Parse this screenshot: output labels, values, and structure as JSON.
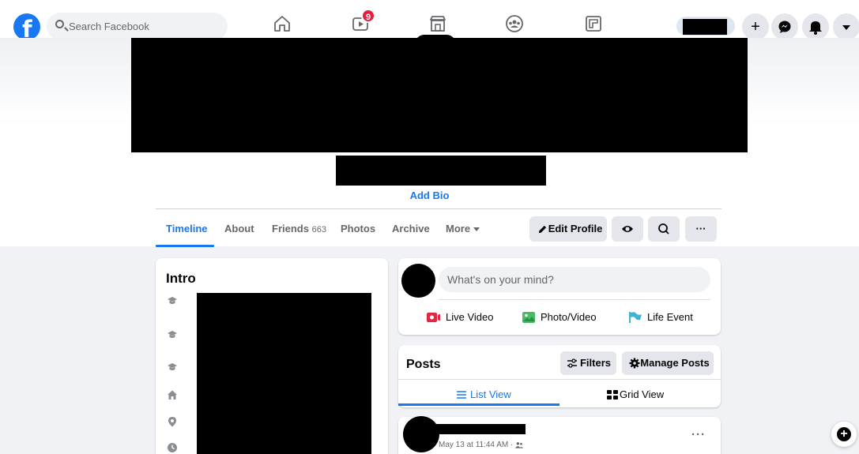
{
  "topbar": {
    "logo_glyph": "f",
    "search_placeholder": "Search Facebook",
    "nav_icons": [
      "home-icon",
      "watch-icon",
      "marketplace-icon",
      "groups-icon",
      "gaming-icon"
    ],
    "watch_badge": "9",
    "right_buttons": [
      "plus-icon",
      "messenger-icon",
      "bell-icon",
      "caret-down-icon"
    ],
    "accent": "#1877f2",
    "badge_color": "#e41e3f"
  },
  "profile": {
    "add_bio": "Add Bio"
  },
  "tabs": {
    "timeline": "Timeline",
    "about": "About",
    "friends": "Friends",
    "friends_count": "663",
    "photos": "Photos",
    "archive": "Archive",
    "more": "More"
  },
  "actions": {
    "edit_profile": "Edit Profile"
  },
  "intro": {
    "title": "Intro",
    "icons": [
      "graduation-cap-icon",
      "graduation-cap-icon",
      "graduation-cap-icon",
      "home-icon",
      "location-pin-icon",
      "clock-icon"
    ]
  },
  "composer": {
    "placeholder": "What's on your mind?",
    "live_video": "Live Video",
    "photo_video": "Photo/Video",
    "life_event": "Life Event"
  },
  "posts": {
    "title": "Posts",
    "filters": "Filters",
    "manage_posts": "Manage Posts",
    "list_view": "List View",
    "grid_view": "Grid View"
  },
  "post": {
    "meta": "May 13 at 11:44 AM ·"
  }
}
